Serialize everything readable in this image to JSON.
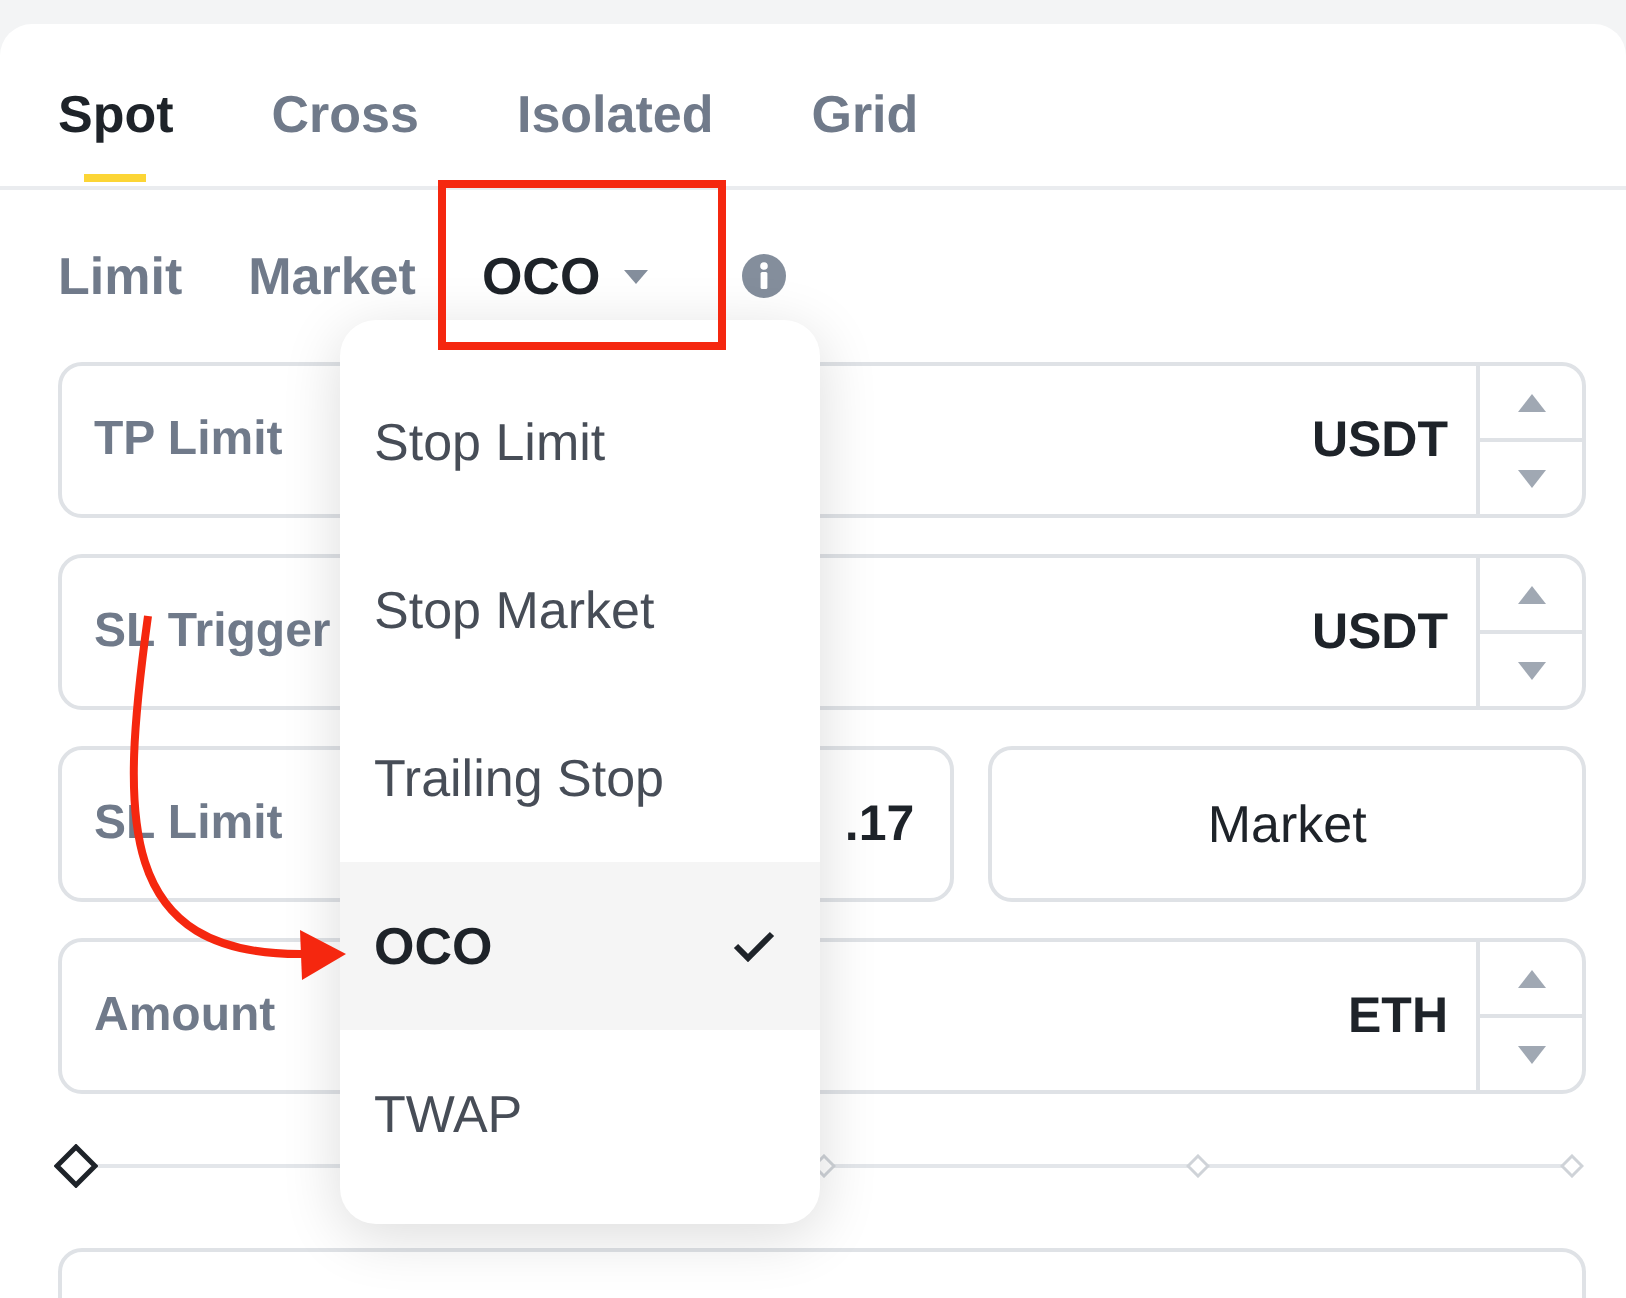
{
  "tabs": [
    {
      "label": "Spot",
      "selected": true
    },
    {
      "label": "Cross",
      "selected": false
    },
    {
      "label": "Isolated",
      "selected": false
    },
    {
      "label": "Grid",
      "selected": false
    }
  ],
  "order_types": [
    {
      "label": "Limit",
      "kind": "option",
      "selected": false
    },
    {
      "label": "Market",
      "kind": "option",
      "selected": false
    },
    {
      "label": "OCO",
      "kind": "menu",
      "selected": true
    }
  ],
  "fields": [
    {
      "kind": "stepper",
      "label": "TP Limit",
      "unit": "USDT"
    },
    {
      "kind": "stepper",
      "label": "SL Trigger",
      "unit": "USDT"
    },
    {
      "kind": "split",
      "label": "SL Limit",
      "value": ".17",
      "button": "Market"
    },
    {
      "kind": "stepper",
      "label": "Amount",
      "unit": "ETH"
    }
  ],
  "slider": {
    "level": 0
  },
  "bottom_fields": [
    {
      "kind": "blank"
    }
  ],
  "dropdown": {
    "items": [
      {
        "label": "Stop Limit",
        "selected": false
      },
      {
        "label": "Stop Market",
        "selected": false
      },
      {
        "label": "Trailing Stop",
        "selected": false
      },
      {
        "label": "OCO",
        "selected": true
      },
      {
        "label": "TWAP",
        "selected": false
      }
    ]
  }
}
